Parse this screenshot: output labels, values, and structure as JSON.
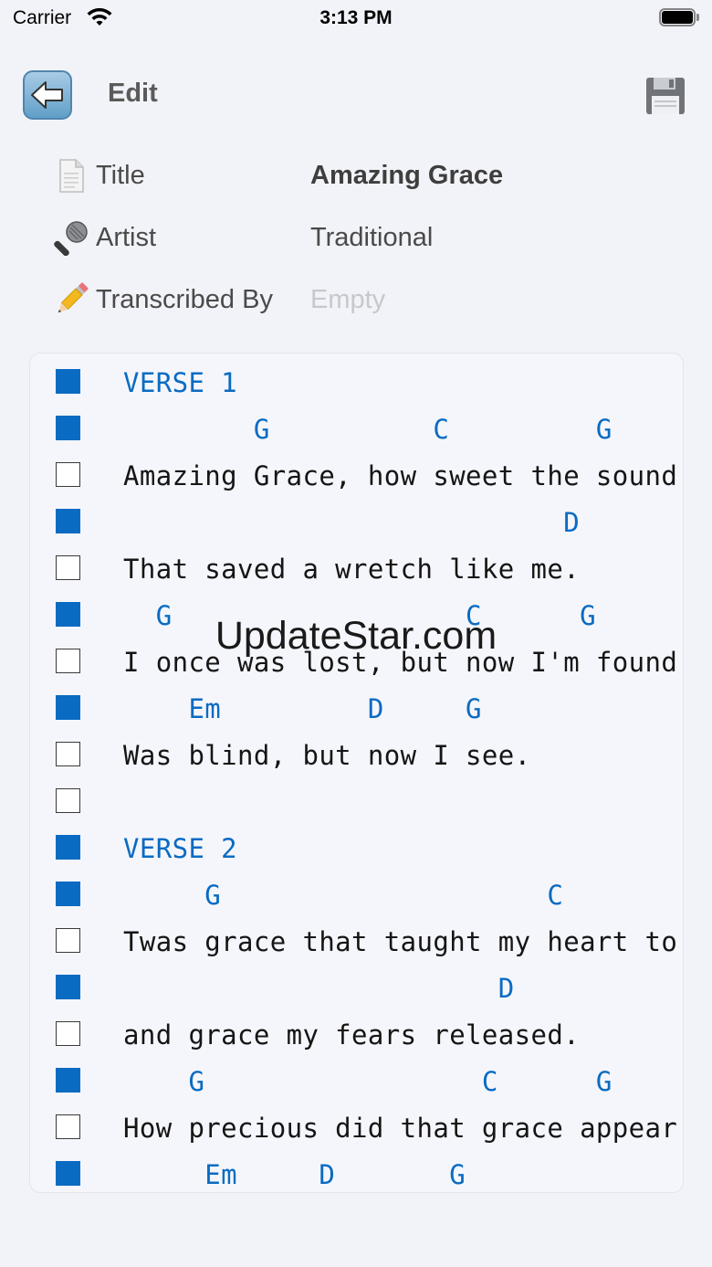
{
  "status_bar": {
    "carrier": "Carrier",
    "time": "3:13 PM"
  },
  "nav": {
    "title": "Edit",
    "back_icon": "left-arrow-icon",
    "save_icon": "floppy-disk-icon"
  },
  "song": {
    "title_label": "Title",
    "title_value": "Amazing Grace",
    "artist_label": "Artist",
    "artist_value": "Traditional",
    "transcriber_label": "Transcribed By",
    "transcriber_placeholder": "Empty"
  },
  "lines": [
    {
      "kind": "section",
      "checked": true,
      "text": "VERSE 1"
    },
    {
      "kind": "chord",
      "checked": true,
      "text": "        G          C         G"
    },
    {
      "kind": "lyric",
      "checked": false,
      "text": "Amazing Grace, how sweet the sound,"
    },
    {
      "kind": "chord",
      "checked": true,
      "text": "                           D"
    },
    {
      "kind": "lyric",
      "checked": false,
      "text": "That saved a wretch like me."
    },
    {
      "kind": "chord",
      "checked": true,
      "text": "  G                  C      G"
    },
    {
      "kind": "lyric",
      "checked": false,
      "text": "I once was lost, but now I'm found,"
    },
    {
      "kind": "chord",
      "checked": true,
      "text": "    Em         D     G"
    },
    {
      "kind": "lyric",
      "checked": false,
      "text": "Was blind, but now I see."
    },
    {
      "kind": "blank",
      "checked": false,
      "text": ""
    },
    {
      "kind": "section",
      "checked": true,
      "text": "VERSE 2"
    },
    {
      "kind": "chord",
      "checked": true,
      "text": "     G                    C"
    },
    {
      "kind": "lyric",
      "checked": false,
      "text": "Twas grace that taught my heart to"
    },
    {
      "kind": "chord",
      "checked": true,
      "text": "                       D"
    },
    {
      "kind": "lyric",
      "checked": false,
      "text": "and grace my fears released."
    },
    {
      "kind": "chord",
      "checked": true,
      "text": "    G                 C      G"
    },
    {
      "kind": "lyric",
      "checked": false,
      "text": "How precious did that grace appear,"
    },
    {
      "kind": "chord",
      "checked": true,
      "text": "     Em     D       G"
    }
  ],
  "watermark": "UpdateStar.com",
  "colors": {
    "accent": "#0a6bc2",
    "background": "#f2f3f8",
    "placeholder": "#c7c7cc"
  }
}
